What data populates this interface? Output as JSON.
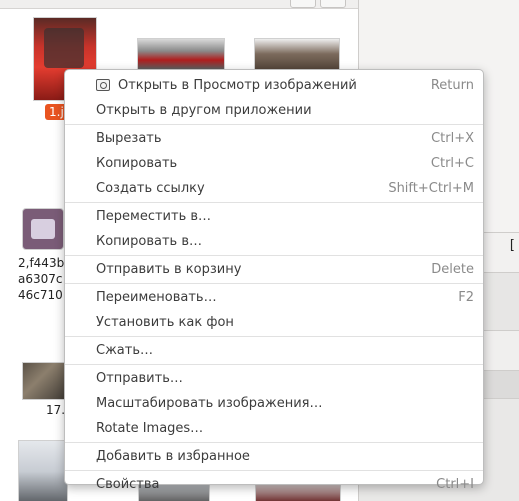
{
  "files": [
    {
      "name": "1.j",
      "selected": true
    },
    {
      "name": "2,f443b\na6307c\n46c710",
      "selected": false
    },
    {
      "name": "17.",
      "selected": false
    }
  ],
  "sidebar_fragment": "[",
  "context_menu": {
    "groups": [
      [
        {
          "label": "Открыть в Просмотр изображений",
          "accel": "Return",
          "icon": "image-viewer-icon"
        },
        {
          "label": "Открыть в другом приложении",
          "accel": ""
        }
      ],
      [
        {
          "label": "Вырезать",
          "accel": "Ctrl+X"
        },
        {
          "label": "Копировать",
          "accel": "Ctrl+C"
        },
        {
          "label": "Создать ссылку",
          "accel": "Shift+Ctrl+M"
        }
      ],
      [
        {
          "label": "Переместить в…",
          "accel": ""
        },
        {
          "label": "Копировать в…",
          "accel": ""
        }
      ],
      [
        {
          "label": "Отправить в корзину",
          "accel": "Delete"
        }
      ],
      [
        {
          "label": "Переименовать…",
          "accel": "F2"
        },
        {
          "label": "Установить как фон",
          "accel": ""
        }
      ],
      [
        {
          "label": "Сжать…",
          "accel": ""
        }
      ],
      [
        {
          "label": "Отправить…",
          "accel": ""
        },
        {
          "label": "Масштабировать изображения…",
          "accel": ""
        },
        {
          "label": "Rotate Images…",
          "accel": ""
        }
      ],
      [
        {
          "label": "Добавить в избранное",
          "accel": ""
        }
      ],
      [
        {
          "label": "Свойства",
          "accel": "Ctrl+I"
        }
      ]
    ]
  }
}
